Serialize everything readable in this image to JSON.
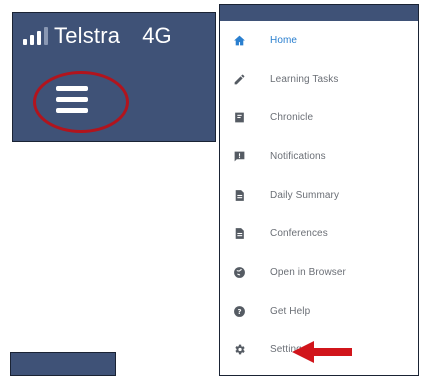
{
  "status_bar": {
    "carrier": "Telstra",
    "network": "4G",
    "signal_bars_shown": 3,
    "signal_bars_total": 4
  },
  "drawer": {
    "items": [
      {
        "label": "Home",
        "icon": "home-icon",
        "active": true
      },
      {
        "label": "Learning Tasks",
        "icon": "pencil-icon",
        "active": false
      },
      {
        "label": "Chronicle",
        "icon": "book-icon",
        "active": false
      },
      {
        "label": "Notifications",
        "icon": "notification-icon",
        "active": false
      },
      {
        "label": "Daily Summary",
        "icon": "document-icon",
        "active": false
      },
      {
        "label": "Conferences",
        "icon": "document-icon",
        "active": false
      },
      {
        "label": "Open in Browser",
        "icon": "globe-icon",
        "active": false
      },
      {
        "label": "Get Help",
        "icon": "help-icon",
        "active": false
      },
      {
        "label": "Settings",
        "icon": "gear-icon",
        "active": false
      }
    ]
  },
  "colors": {
    "header_bg": "#3f5277",
    "accent_active": "#2a7fcf",
    "highlight_red": "#b1141d",
    "menu_text": "#6b6f76"
  }
}
